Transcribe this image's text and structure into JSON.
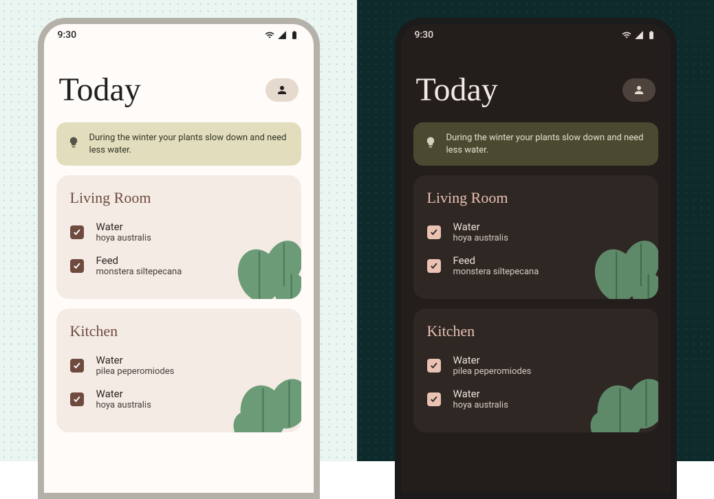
{
  "status": {
    "time": "9:30"
  },
  "header": {
    "title": "Today"
  },
  "tip": {
    "text": "During the winter your plants slow down and need less water."
  },
  "sections": [
    {
      "title": "Living Room",
      "tasks": [
        {
          "action": "Water",
          "plant": "hoya australis",
          "checked": true
        },
        {
          "action": "Feed",
          "plant": "monstera siltepecana",
          "checked": true
        }
      ]
    },
    {
      "title": "Kitchen",
      "tasks": [
        {
          "action": "Water",
          "plant": "pilea peperomiodes",
          "checked": true
        },
        {
          "action": "Water",
          "plant": "hoya australis",
          "checked": true
        }
      ]
    }
  ],
  "themes": {
    "light": {
      "bg": "#FFFBF8",
      "card": "#F4EBE5",
      "banner": "#E2DEBD",
      "accent": "#6F4A3E"
    },
    "dark": {
      "bg": "#231E1C",
      "card": "#2F2724",
      "banner": "#4A4A31",
      "accent": "#E9C2B2"
    }
  }
}
